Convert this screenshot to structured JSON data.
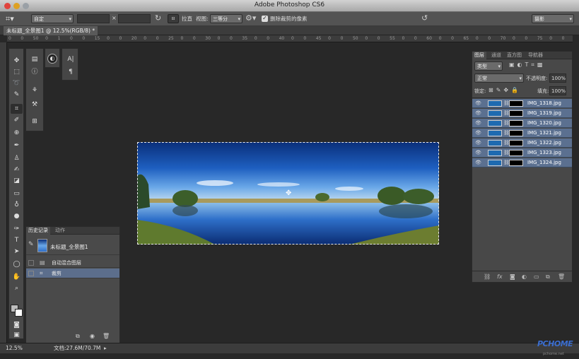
{
  "window": {
    "title": "Adobe Photoshop CS6"
  },
  "options_bar": {
    "ratio": "自定",
    "swap_symbol": "×",
    "straighten_label": "拉直",
    "view_label": "视图:",
    "view_value": "三等分",
    "delete_cropped_label": "删除裁剪的像素",
    "workspace": "摄影"
  },
  "document": {
    "tab": "未标题_全景图1 @ 12.5%(RGB/8) *"
  },
  "ruler": {
    "top": [
      "0",
      "0",
      "50",
      "0",
      "1",
      "0",
      "0",
      "15",
      "0",
      "0",
      "20",
      "0",
      "0",
      "25",
      "0",
      "0",
      "30",
      "0",
      "0",
      "35",
      "0",
      "0",
      "40",
      "0",
      "0",
      "45",
      "0",
      "0",
      "50",
      "0",
      "0",
      "55",
      "0",
      "0",
      "60",
      "0",
      "0",
      "65",
      "0",
      "0",
      "70",
      "0",
      "0",
      "75",
      "0",
      "0"
    ]
  },
  "history_panel": {
    "tab_history": "历史记录",
    "tab_actions": "动作",
    "snapshot_label": "未标题_全景图1",
    "items": [
      "自动混合图层",
      "裁剪"
    ]
  },
  "layers_panel": {
    "tabs": [
      "图层",
      "通道",
      "直方图",
      "导航器"
    ],
    "filter_kind": "类型",
    "blend_mode": "正常",
    "opacity_label": "不透明度:",
    "opacity": "100%",
    "lock_label": "锁定:",
    "fill_label": "填充:",
    "fill": "100%",
    "layers": [
      "IMG_1318.jpg",
      "IMG_1319.jpg",
      "IMG_1320.jpg",
      "IMG_1321.jpg",
      "IMG_1322.jpg",
      "IMG_1323.jpg",
      "IMG_1324.jpg"
    ]
  },
  "status": {
    "zoom": "12.5%",
    "doc": "文档:27.6M/70.7M"
  },
  "watermark": {
    "brand": "PCHOME",
    "url": "pchome.net"
  }
}
